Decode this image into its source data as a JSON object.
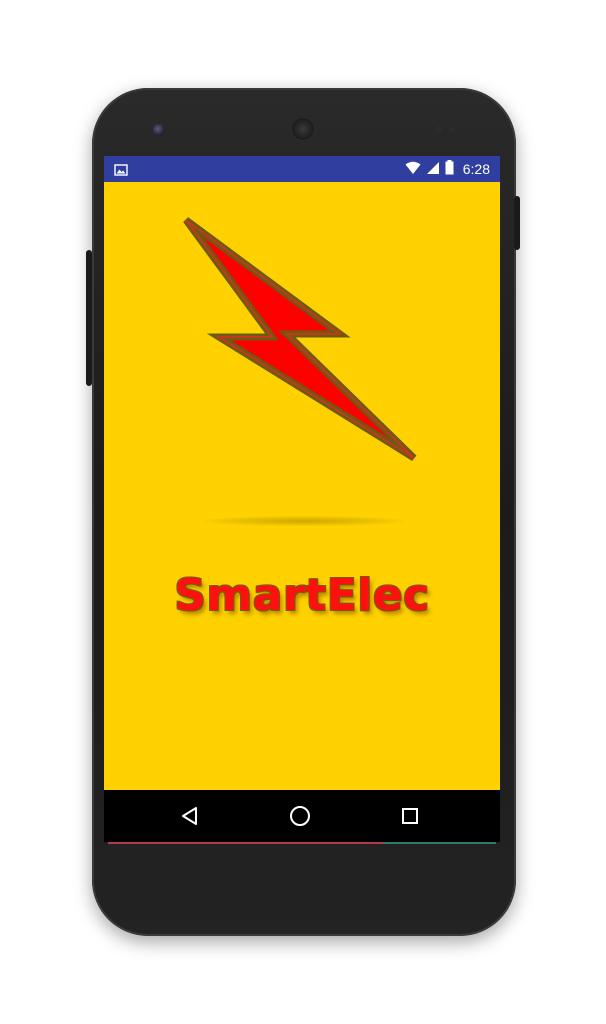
{
  "status_bar": {
    "time": "6:28",
    "background_color": "#303f9f",
    "left_icon": "image-notification-icon",
    "right_icons": [
      "wifi-icon",
      "cellular-signal-icon",
      "battery-icon"
    ]
  },
  "app": {
    "title": "SmartElec",
    "background_color": "#ffd100",
    "title_color": "#ff1010",
    "logo_icon": "lightning-bolt-icon",
    "logo_fill_color": "#ff0000",
    "logo_outline_color": "#6b5a12"
  },
  "navigation_bar": {
    "background_color": "#000000",
    "buttons": [
      "back-icon",
      "home-icon",
      "recents-icon"
    ]
  },
  "device": {
    "color": "#1b1b1b"
  }
}
